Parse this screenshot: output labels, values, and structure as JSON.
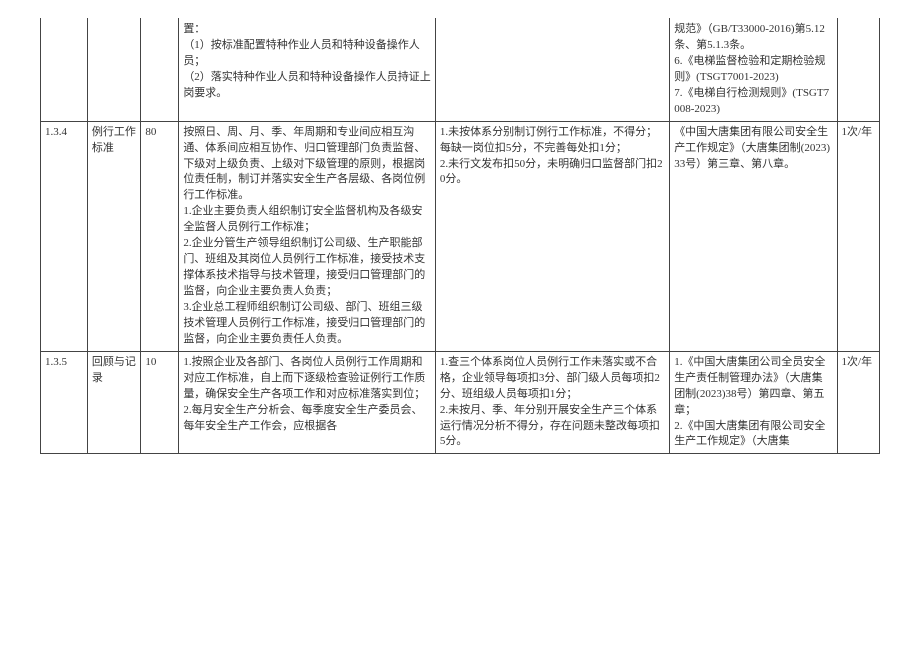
{
  "rows": [
    {
      "id": "",
      "name": "",
      "score": "",
      "desc": "置：\n（1）按标准配置特种作业人员和特种设备操作人员；\n（2）落实特种作业人员和特种设备操作人员持证上岗要求。",
      "criteria": "",
      "refs": "规范》（GB/T33000-2016)第5.12条、第5.1.3条。\n6.《电梯监督检验和定期检验规则》(TSGT7001-2023)\n7.《电梯自行检测规则》(TSGT7008-2023)",
      "freq": ""
    },
    {
      "id": "1.3.4",
      "name": "例行工作标准",
      "score": "80",
      "desc": "按照日、周、月、季、年周期和专业间应相互沟通、体系间应相互协作、归口管理部门负责监督、下级对上级负责、上级对下级管理的原则，根据岗位责任制，制订并落实安全生产各层级、各岗位例行工作标准。\n1.企业主要负责人组织制订安全监督机构及各级安全监督人员例行工作标准；\n2.企业分管生产领导组织制订公司级、生产职能部门、班组及其岗位人员例行工作标准，接受技术支撑体系技术指导与技术管理，接受归口管理部门的监督，向企业主要负责人负责；\n3.企业总工程师组织制订公司级、部门、班组三级技术管理人员例行工作标准，接受归口管理部门的监督，向企业主要负责任人负责。",
      "criteria": "1.未按体系分别制订例行工作标准，不得分；每缺一岗位扣5分，不完善每处扣1分；\n2.未行文发布扣50分，未明确归口监督部门扣20分。",
      "refs": "《中国大唐集团有限公司安全生产工作规定》（大唐集团制(2023)33号）第三章、第八章。",
      "freq": "1次/年"
    },
    {
      "id": "1.3.5",
      "name": "回顾与记录",
      "score": "10",
      "desc": "1.按照企业及各部门、各岗位人员例行工作周期和对应工作标准，自上而下逐级检查验证例行工作质量，确保安全生产各项工作和对应标准落实到位；\n2.每月安全生产分析会、每季度安全生产委员会、每年安全生产工作会，应根据各",
      "criteria": "1.查三个体系岗位人员例行工作未落实或不合格，企业领导每项扣3分、部门级人员每项扣2分、班组级人员每项扣1分；\n2.未按月、季、年分别开展安全生产三个体系运行情况分析不得分，存在问题未整改每项扣5分。",
      "refs": "1.《中国大唐集团公司全员安全生产责任制管理办法》（大唐集团制(2023)38号）第四章、第五章；\n2.《中国大唐集团有限公司安全生产工作规定》（大唐集",
      "freq": "1次/年"
    }
  ]
}
